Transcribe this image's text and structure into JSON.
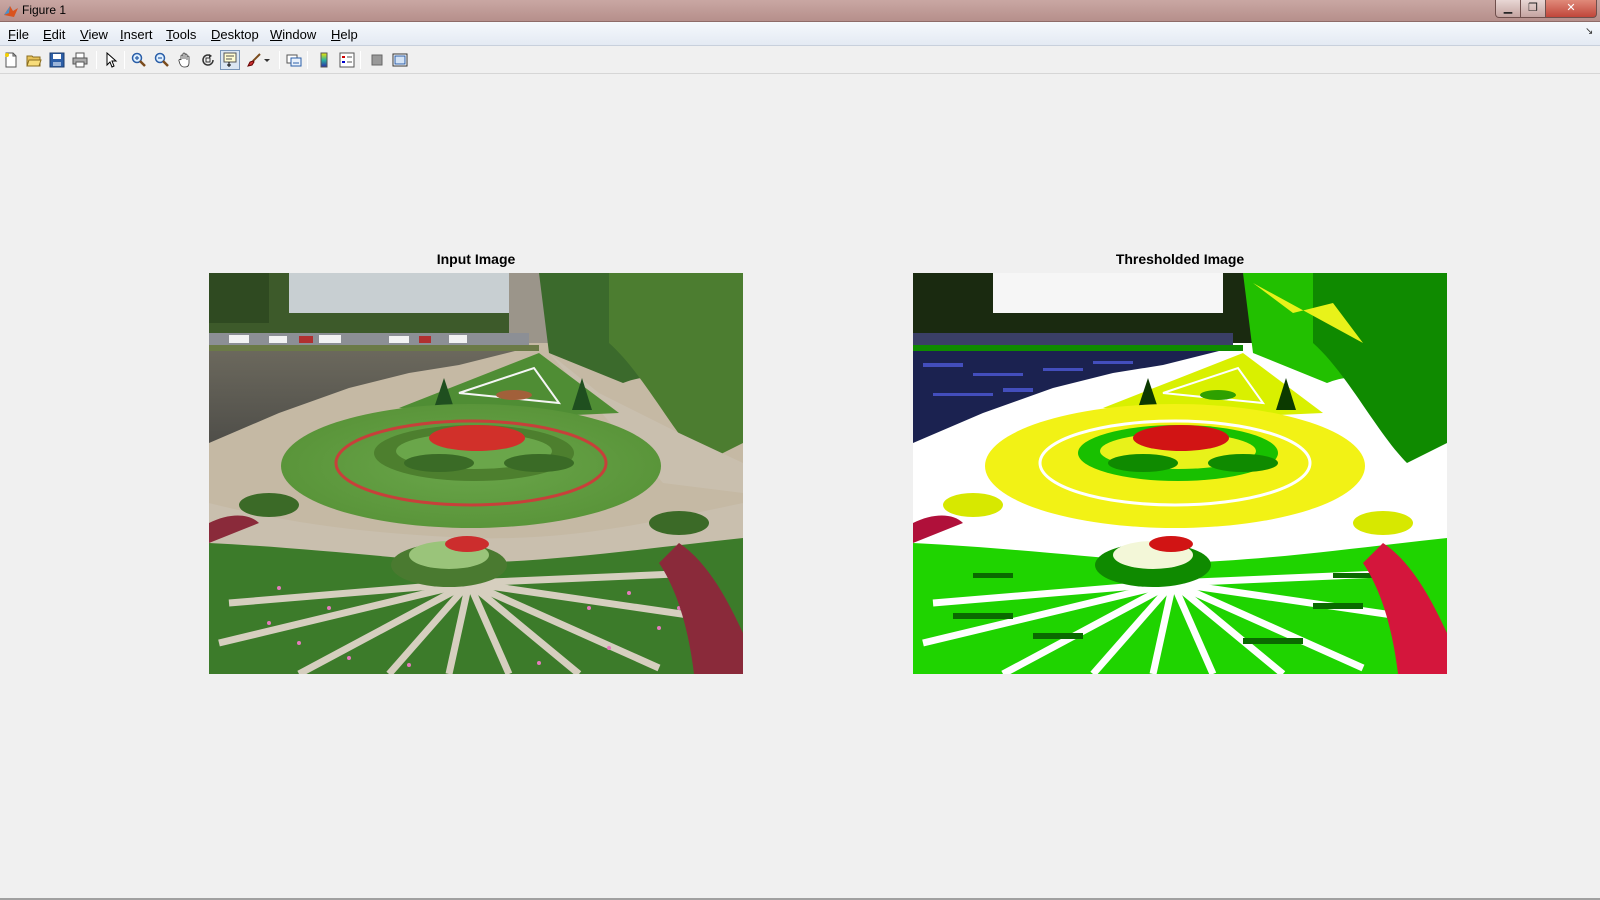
{
  "window": {
    "title": "Figure 1",
    "minimize_glyph": "▁",
    "maximize_glyph": "❐",
    "close_glyph": "✕"
  },
  "menu": [
    {
      "label": "File",
      "accel": "F"
    },
    {
      "label": "Edit",
      "accel": "E"
    },
    {
      "label": "View",
      "accel": "V"
    },
    {
      "label": "Insert",
      "accel": "I"
    },
    {
      "label": "Tools",
      "accel": "T"
    },
    {
      "label": "Desktop",
      "accel": "D"
    },
    {
      "label": "Window",
      "accel": "W"
    },
    {
      "label": "Help",
      "accel": "H"
    }
  ],
  "toolbar": {
    "icons": [
      "new-figure-icon",
      "open-file-icon",
      "save-icon",
      "print-icon",
      "edit-plot-icon",
      "zoom-in-icon",
      "zoom-out-icon",
      "pan-icon",
      "rotate-3d-icon",
      "data-cursor-icon",
      "brush-icon",
      "link-plot-icon",
      "colorbar-icon",
      "legend-icon",
      "hide-plot-tools-icon",
      "show-plot-tools-icon"
    ],
    "pressed": "data-cursor-icon"
  },
  "plots": {
    "left_title": "Input Image",
    "right_title": "Thresholded Image"
  },
  "colors": {
    "titlebar": "#c4a19d",
    "menubar": "#e9eef5",
    "figure_bg": "#f0f0f0",
    "grass": "#5e9e3c",
    "thresh_green": "#1fd400",
    "thresh_yellow": "#e8f21a"
  }
}
